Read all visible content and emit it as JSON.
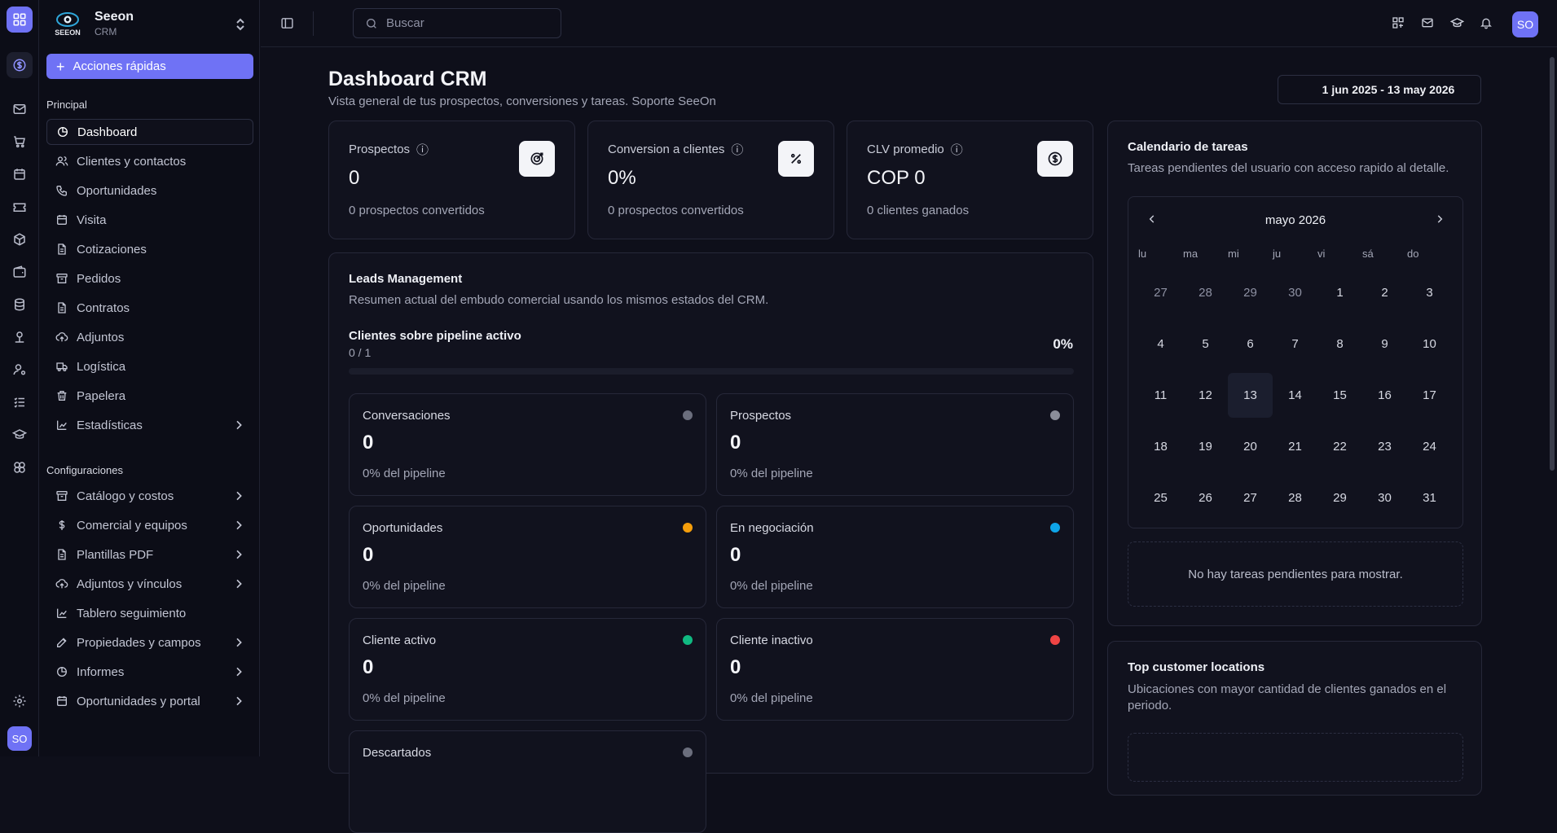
{
  "rail": {
    "avatar": "SO"
  },
  "brand": {
    "logo_text": "SEEON",
    "name": "Seeon",
    "sub": "CRM"
  },
  "quick_actions": "Acciones rápidas",
  "sections": {
    "principal": "Principal",
    "config": "Configuraciones"
  },
  "nav": [
    {
      "label": "Dashboard",
      "icon": "chart-pie-icon"
    },
    {
      "label": "Clientes y contactos",
      "icon": "users-icon"
    },
    {
      "label": "Oportunidades",
      "icon": "phone-icon"
    },
    {
      "label": "Visita",
      "icon": "calendar-icon"
    },
    {
      "label": "Cotizaciones",
      "icon": "file-icon"
    },
    {
      "label": "Pedidos",
      "icon": "archive-icon"
    },
    {
      "label": "Contratos",
      "icon": "file-icon"
    },
    {
      "label": "Adjuntos",
      "icon": "cloud-upload-icon"
    },
    {
      "label": "Logística",
      "icon": "truck-icon"
    },
    {
      "label": "Papelera",
      "icon": "trash-icon"
    },
    {
      "label": "Estadísticas",
      "icon": "bar-chart-icon"
    }
  ],
  "config_nav": [
    {
      "label": "Catálogo y costos",
      "icon": "archive-icon"
    },
    {
      "label": "Comercial y equipos",
      "icon": "dollar-icon"
    },
    {
      "label": "Plantillas PDF",
      "icon": "file-icon"
    },
    {
      "label": "Adjuntos y vínculos",
      "icon": "cloud-upload-icon"
    },
    {
      "label": "Tablero seguimiento",
      "icon": "bar-chart-icon"
    },
    {
      "label": "Propiedades y campos",
      "icon": "edit-icon"
    },
    {
      "label": "Informes",
      "icon": "chart-pie-icon"
    },
    {
      "label": "Oportunidades y portal",
      "icon": "calendar-icon"
    }
  ],
  "topbar": {
    "search_placeholder": "Buscar",
    "avatar": "SO"
  },
  "page": {
    "title": "Dashboard CRM",
    "subtitle": "Vista general de tus prospectos, conversiones y tareas. Soporte SeeOn",
    "date_range": "1 jun 2025 - 13 may 2026"
  },
  "kpis": [
    {
      "label": "Prospectos",
      "value": "0",
      "foot": "0 prospectos convertidos",
      "icon": "target-icon"
    },
    {
      "label": "Conversion a clientes",
      "value": "0%",
      "foot": "0 prospectos convertidos",
      "icon": "percent-icon"
    },
    {
      "label": "CLV promedio",
      "value": "COP 0",
      "foot": "0 clientes ganados",
      "icon": "dollar-circle-icon"
    }
  ],
  "leads": {
    "title": "Leads Management",
    "desc": "Resumen actual del embudo comercial usando los mismos estados del CRM.",
    "pipeline_label": "Clientes sobre pipeline activo",
    "pipeline_count": "0 / 1",
    "pipeline_pct": "0%",
    "pipeline_fraction": 0,
    "stages": [
      {
        "name": "Conversaciones",
        "value": "0",
        "foot": "0% del pipeline",
        "color": "#6b6e7d"
      },
      {
        "name": "Prospectos",
        "value": "0",
        "foot": "0% del pipeline",
        "color": "#8a8d99"
      },
      {
        "name": "Oportunidades",
        "value": "0",
        "foot": "0% del pipeline",
        "color": "#f59e0b"
      },
      {
        "name": "En negociación",
        "value": "0",
        "foot": "0% del pipeline",
        "color": "#0ea5e9"
      },
      {
        "name": "Cliente activo",
        "value": "0",
        "foot": "0% del pipeline",
        "color": "#10b981"
      },
      {
        "name": "Cliente inactivo",
        "value": "0",
        "foot": "0% del pipeline",
        "color": "#ef4444"
      },
      {
        "name": "Descartados",
        "value": "",
        "foot": "",
        "color": "#6b6e7d"
      }
    ]
  },
  "calendar": {
    "title": "Calendario de tareas",
    "desc": "Tareas pendientes del usuario con acceso rapido al detalle.",
    "month": "mayo 2026",
    "weekdays": [
      "lu",
      "ma",
      "mi",
      "ju",
      "vi",
      "sá",
      "do"
    ],
    "days": [
      "27",
      "28",
      "29",
      "30",
      "1",
      "2",
      "3",
      "4",
      "5",
      "6",
      "7",
      "8",
      "9",
      "10",
      "11",
      "12",
      "13",
      "14",
      "15",
      "16",
      "17",
      "18",
      "19",
      "20",
      "21",
      "22",
      "23",
      "24",
      "25",
      "26",
      "27",
      "28",
      "29",
      "30",
      "31"
    ],
    "muted_count": 4,
    "today": "13",
    "empty": "No hay tareas pendientes para mostrar."
  },
  "locations": {
    "title": "Top customer locations",
    "desc": "Ubicaciones con mayor cantidad de clientes ganados en el periodo."
  }
}
